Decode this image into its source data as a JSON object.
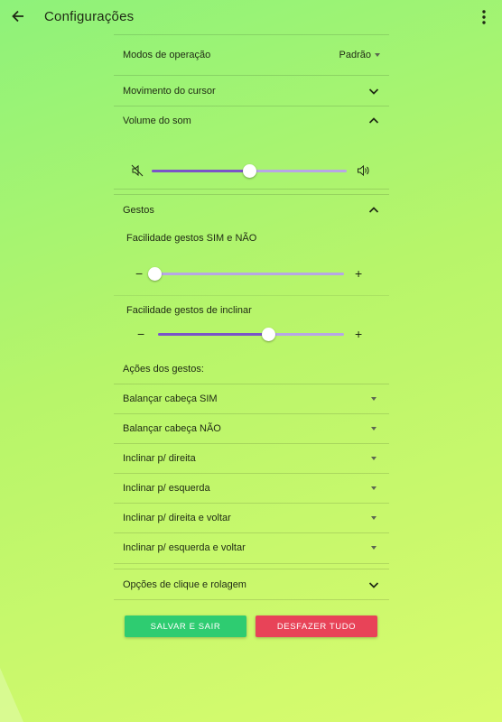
{
  "header": {
    "title": "Configurações"
  },
  "modes": {
    "label": "Modos de operação",
    "value": "Padrão"
  },
  "cursor_section": {
    "label": "Movimento do cursor"
  },
  "volume_section": {
    "label": "Volume do som",
    "level": 0.5
  },
  "gestures_section": {
    "label": "Gestos",
    "yes_no": {
      "label": "Facilidade gestos SIM e NÃO",
      "level": 0.0,
      "minus": "−",
      "plus": "+"
    },
    "tilt": {
      "label": "Facilidade gestos de inclinar",
      "level": 0.59,
      "minus": "−",
      "plus": "+"
    },
    "actions_label": "Ações dos gestos:",
    "actions": [
      {
        "label": "Balançar cabeça SIM"
      },
      {
        "label": "Balançar cabeça NÃO"
      },
      {
        "label": "Inclinar p/ direita"
      },
      {
        "label": "Inclinar p/ esquerda"
      },
      {
        "label": "Inclinar p/ direita e voltar"
      },
      {
        "label": "Inclinar p/ esquerda e voltar"
      }
    ]
  },
  "click_section": {
    "label": "Opções de clique e rolagem"
  },
  "buttons": {
    "save": "SALVAR E SAIR",
    "undo": "DESFAZER TUDO"
  },
  "colors": {
    "save": "#2ecc71",
    "undo": "#e84358",
    "slider_fill": "#7a54c8",
    "slider_track": "#b7a6e6"
  }
}
